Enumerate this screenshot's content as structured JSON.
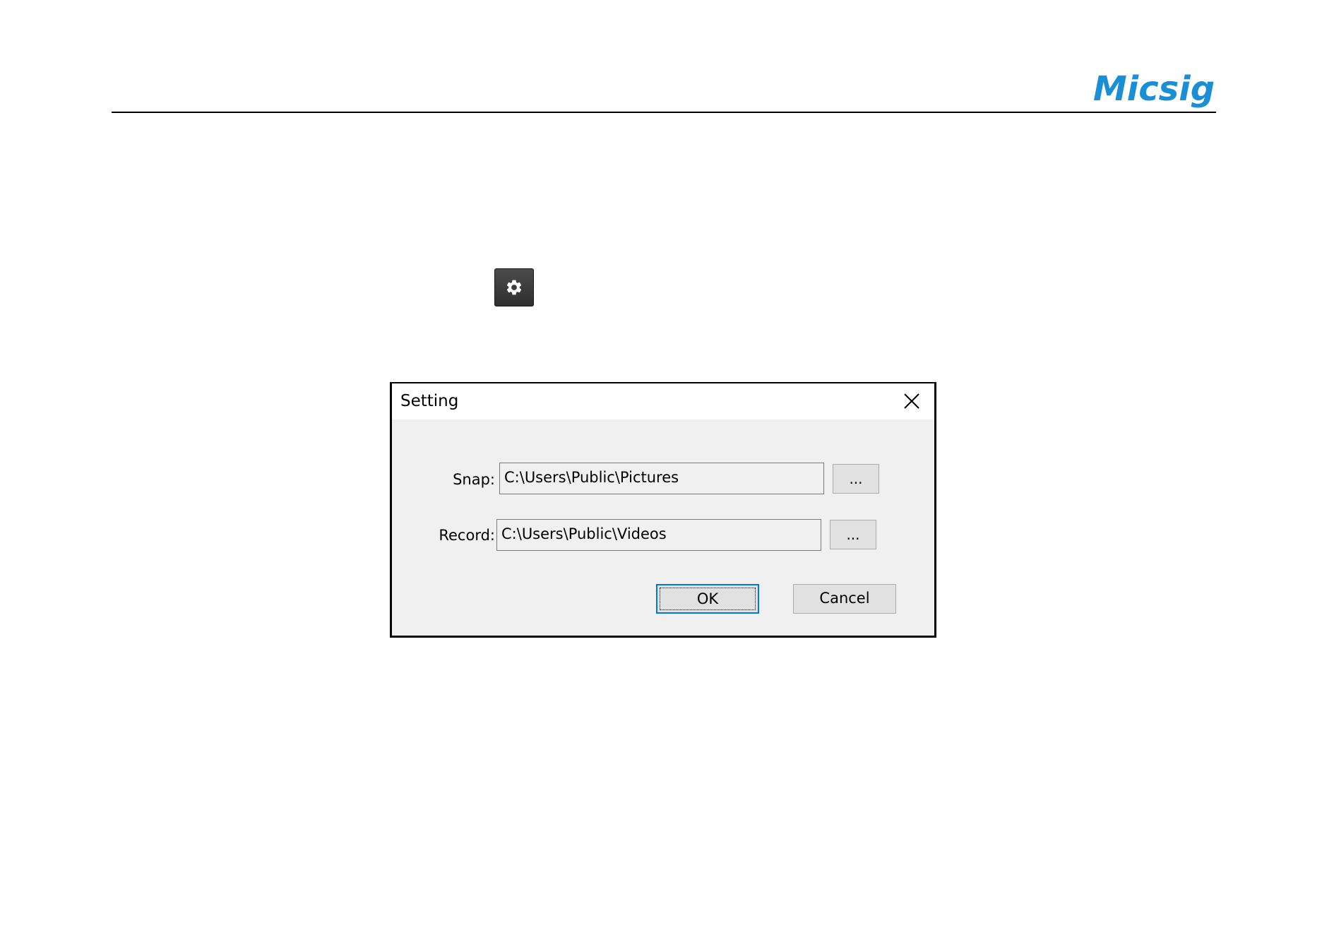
{
  "brand": {
    "logo_text": "Micsig",
    "logo_color": "#1a8fd6"
  },
  "toolbar": {
    "settings_icon": "gear-icon"
  },
  "dialog": {
    "title": "Setting",
    "close_icon": "close-icon",
    "snap": {
      "label": "Snap:",
      "value": "C:\\Users\\Public\\Pictures",
      "browse_label": "..."
    },
    "record": {
      "label": "Record:",
      "value": "C:\\Users\\Public\\Videos",
      "browse_label": "..."
    },
    "ok_label": "OK",
    "cancel_label": "Cancel",
    "default_button_color": "#0078d7"
  }
}
